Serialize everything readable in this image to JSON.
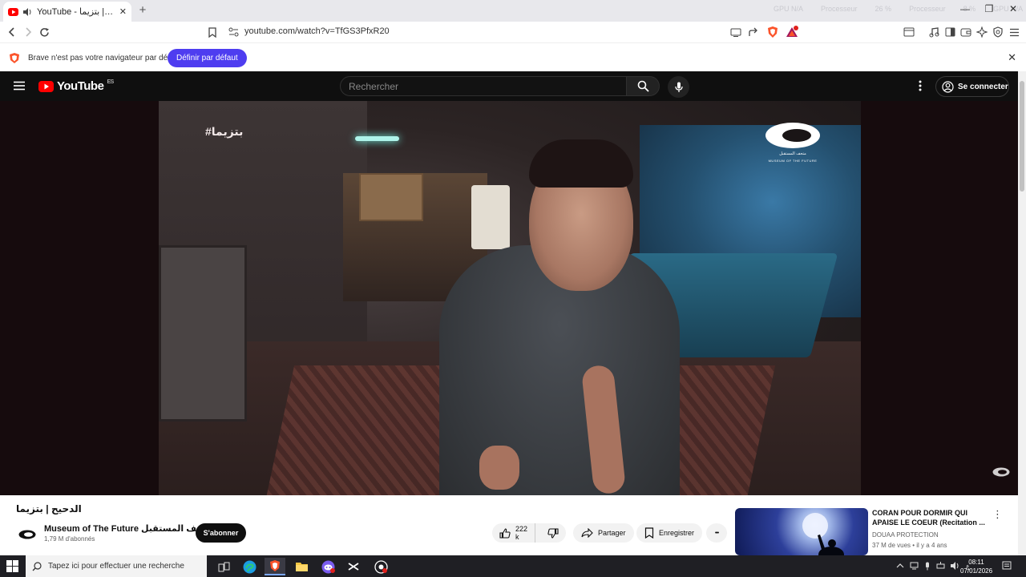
{
  "browser": {
    "tab_title": "YouTube - الدحيح | بتزيما",
    "new_tab": "+",
    "ghost_stats": [
      "GPU N/A",
      "Processeur",
      "26 %",
      "Processeur",
      "8 %",
      "GPU N/A"
    ],
    "url": "youtube.com/watch?v=TfGS3PfxR20",
    "shield_badge": "24",
    "infobar_message": "Brave n'est pas votre navigateur par défaut",
    "infobar_button": "Définir par défaut",
    "infobar_close": "✕",
    "window_controls": [
      "—",
      "❐",
      "✕"
    ]
  },
  "youtube": {
    "logo_text": "YouTube",
    "region": "ES",
    "search_placeholder": "Rechercher",
    "sign_in": "Se connecter"
  },
  "video": {
    "overlay_tag": "#بتزيما",
    "museum_ar": "متحف المستقبل",
    "museum_en": "MUSEUM OF THE FUTURE",
    "title": "الدحيح | بتزيما",
    "channel": "Museum of The Future متحف المستقبل",
    "subscribers": "1,79 M d'abonnés",
    "subscribe": "S'abonner",
    "likes": "222 k",
    "share": "Partager",
    "save": "Enregistrer",
    "more": "•••"
  },
  "suggestion": {
    "title": "CORAN POUR DORMIR QUI APAISE LE COEUR (Recitation ...",
    "channel": "DOUAA PROTECTION",
    "meta": "37 M de vues • il y a 4 ans",
    "more": "⋮"
  },
  "taskbar": {
    "search_placeholder": "Tapez ici pour effectuer une recherche",
    "time": "08:11",
    "date": "07/01/2026"
  },
  "colors": {
    "yt_red": "#ff0000",
    "brave_purple": "#4e3df0",
    "yt_dark": "#0f0f0f"
  }
}
